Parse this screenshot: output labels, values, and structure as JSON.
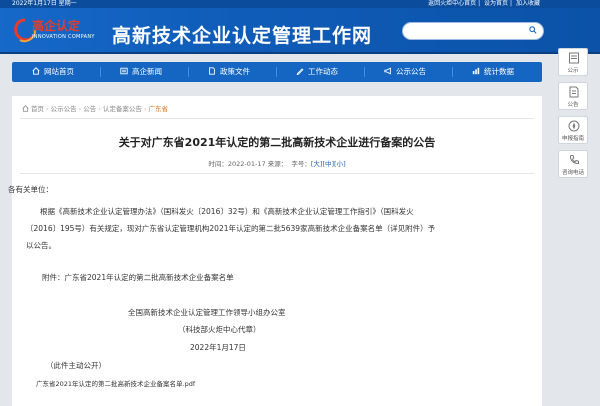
{
  "topbar": {
    "date": "2022年1月17日 星期一",
    "links": [
      "返回火炬中心首页",
      "设为首页",
      "加入收藏"
    ]
  },
  "header": {
    "logo_cn": "高企认定",
    "logo_en": "INNOVATION COMPANY",
    "site_title": "高新技术企业认定管理工作网",
    "search_placeholder": ""
  },
  "nav": {
    "items": [
      {
        "label": "网站首页",
        "icon": "home-icon"
      },
      {
        "label": "高企新闻",
        "icon": "news-icon"
      },
      {
        "label": "政策文件",
        "icon": "document-icon"
      },
      {
        "label": "工作动态",
        "icon": "pen-icon"
      },
      {
        "label": "公示公告",
        "icon": "megaphone-icon"
      },
      {
        "label": "统计数据",
        "icon": "chart-icon"
      }
    ]
  },
  "breadcrumb": {
    "items": [
      "首页",
      "公示公告",
      "公告",
      "认定备案公告"
    ],
    "current": "广东省"
  },
  "article": {
    "title": "关于对广东省2021年认定的第二批高新技术企业进行备案的公告",
    "date_prefix": "时间：2022-01-17 来源：",
    "font_prefix": "字号：",
    "font_sizes": [
      "[大]",
      "[中]",
      "[小]"
    ],
    "salutation": "各有关单位：",
    "body_line1": "根据《高新技术企业认定管理办法》（国科发火〔2016〕32号）和《高新技术企业认定管理工作指引》（国科发火",
    "body_line2": "〔2016〕195号）有关规定，现对广东省认定管理机构2021年认定的第二批5639家高新技术企业备案名单（详见附件）予",
    "body_line3": "以公告。",
    "attachment": "附件：广东省2021年认定的第二批高新技术企业备案名单",
    "signature_org": "全国高新技术企业认定管理工作领导小组办公室",
    "signature_sub": "（科技部火炬中心代章）",
    "signature_date": "2022年1月17日",
    "disclosure": "（此件主动公开）",
    "attachment_file": "广东省2021年认定的第二批高新技术企业备案名单.pdf"
  },
  "sidebar": {
    "buttons": [
      {
        "label": "公示",
        "icon": "notice-icon"
      },
      {
        "label": "公告",
        "icon": "announcement-icon"
      },
      {
        "label": "申报指南",
        "icon": "compass-icon"
      },
      {
        "label": "咨询电话",
        "icon": "phone-icon"
      }
    ]
  },
  "colors": {
    "brand_blue": "#0f5cb8",
    "nav_blue": "#1566c3",
    "logo_red": "#e63c2b",
    "breadcrumb_current": "#e07a2a"
  }
}
